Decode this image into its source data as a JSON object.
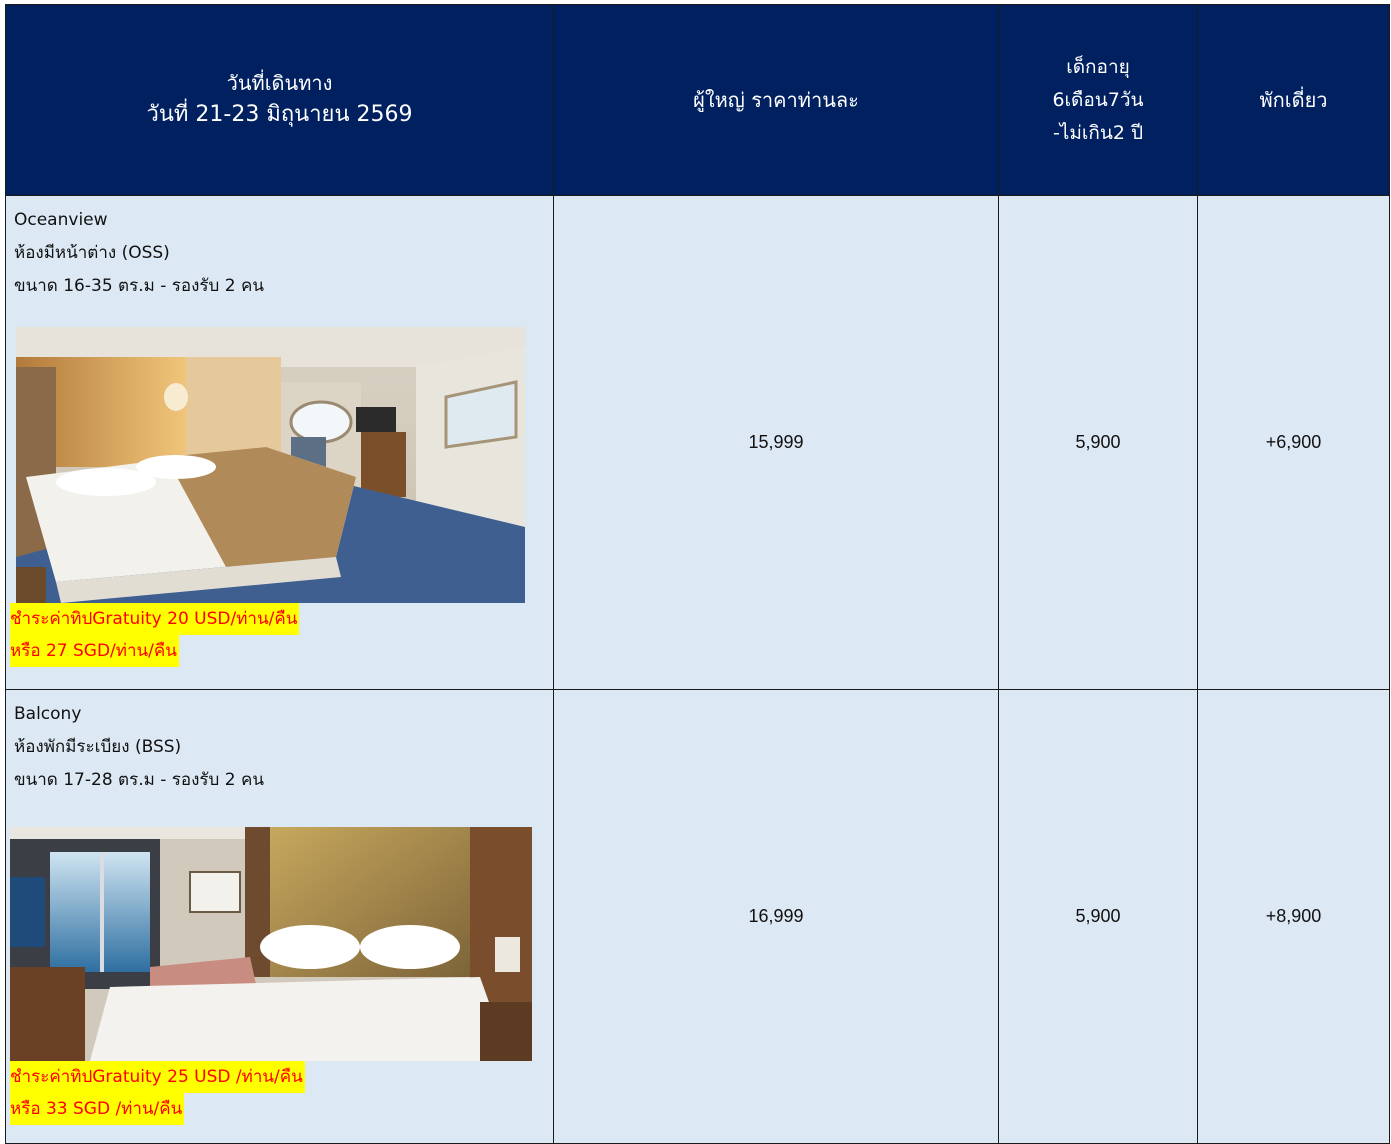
{
  "header": {
    "col1_line1": "วันที่เดินทาง",
    "col1_line2": "วันที่ 21-23 มิถุนายน 2569",
    "col2": "ผู้ใหญ่ ราคาท่านละ",
    "col3_line1": "เด็กอายุ",
    "col3_line2": "6เดือน7วัน",
    "col3_line3": "-ไม่เกิน2 ปี",
    "col4": "พักเดี่ยว"
  },
  "rooms": [
    {
      "type": "Oceanview",
      "name": "ห้องมีหน้าต่าง (OSS)",
      "size": "ขนาด 16-35 ตร.ม - รองรับ 2 คน",
      "note_line1": "ชำระค่าทิปGratuity 20 USD/ท่าน/คืน",
      "note_line2": "หรือ 27 SGD/ท่าน/คืน",
      "adult_price": "15,999",
      "child_price": "5,900",
      "single_supplement": "+6,900"
    },
    {
      "type": "Balcony",
      "name": "ห้องพักมีระเบียง (BSS)",
      "size": "ขนาด 17-28 ตร.ม - รองรับ 2 คน",
      "note_line1": "ชำระค่าทิปGratuity 25 USD /ท่าน/คืน",
      "note_line2": "หรือ 33 SGD /ท่าน/คืน",
      "adult_price": "16,999",
      "child_price": "5,900",
      "single_supplement": "+8,900"
    }
  ],
  "colors": {
    "header_bg": "#002060",
    "row_bg": "#dde8f5",
    "highlight_bg": "#ffff00",
    "highlight_text": "#ff0000"
  }
}
